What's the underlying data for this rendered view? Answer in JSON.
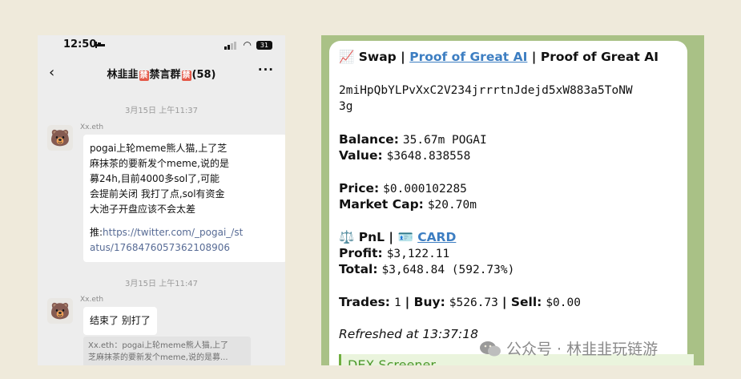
{
  "phone": {
    "status": {
      "time": "12:50",
      "battery": "31"
    },
    "chat_title_prefix": "林韭韭",
    "chat_title_badge": "禁",
    "chat_title_mid": "禁言群",
    "chat_title_badge2": "禁",
    "chat_title_count": "(58)",
    "more": "···",
    "timestamps": [
      "3月15日 上午11:37",
      "3月15日 上午11:47"
    ],
    "messages": [
      {
        "sender": "Xx.eth",
        "lines": [
          "pogai上轮meme熊人猫,上了芝",
          "麻抹茶的要新发个meme,说的是",
          "募24h,目前4000多sol了,可能",
          "会提前关闭 我打了点,sol有资金",
          "大池子开盘应该不会太差"
        ],
        "link_prefix": "推:",
        "link_lines": [
          "https://twitter.com/_pogai_/st",
          "atus/1768476057362108906"
        ]
      },
      {
        "sender": "Xx.eth",
        "text": "结束了 别打了",
        "quote_lines": [
          "Xx.eth：pogai上轮meme熊人猫,上了",
          "芝麻抹茶的要新发个meme,说的是募..."
        ]
      }
    ]
  },
  "telegram": {
    "swap_emoji": "📈",
    "swap_label": "Swap |",
    "swap_link": "Proof of Great AI",
    "swap_suffix": "| Proof of Great AI",
    "address_line1": "2miHpQbYLPvXxC2V234jrrrtnJdejd5xW883a5ToNW",
    "address_line2": "3g",
    "balance_label": "Balance:",
    "balance_value": "35.67m POGAI",
    "value_label": "Value:",
    "value_value": "$3648.838558",
    "price_label": "Price:",
    "price_value": "$0.000102285",
    "mcap_label": "Market Cap:",
    "mcap_value": "$20.70m",
    "pnl_emoji": "⚖️",
    "pnl_label": "PnL |",
    "card_emoji": "🪪",
    "card_link": "CARD",
    "profit_label": "Profit:",
    "profit_value": "$3,122.11",
    "total_label": "Total:",
    "total_value": "$3,648.84 (592.73%)",
    "trades_label": "Trades:",
    "trades_value": "1",
    "buy_label": "| Buy:",
    "buy_value": "$526.73",
    "sell_label": "| Sell:",
    "sell_value": "$0.00",
    "refreshed": "Refreshed at 13:37:18",
    "dex_label": "DEX Screener"
  },
  "watermark": {
    "text": "公众号 · 林韭韭玩链游"
  },
  "colors": {
    "background": "#efeadb",
    "chat_bg": "#ededed",
    "tg_bg": "#a9c186",
    "link": "#3d7ec2",
    "badge": "#e45a4a"
  }
}
